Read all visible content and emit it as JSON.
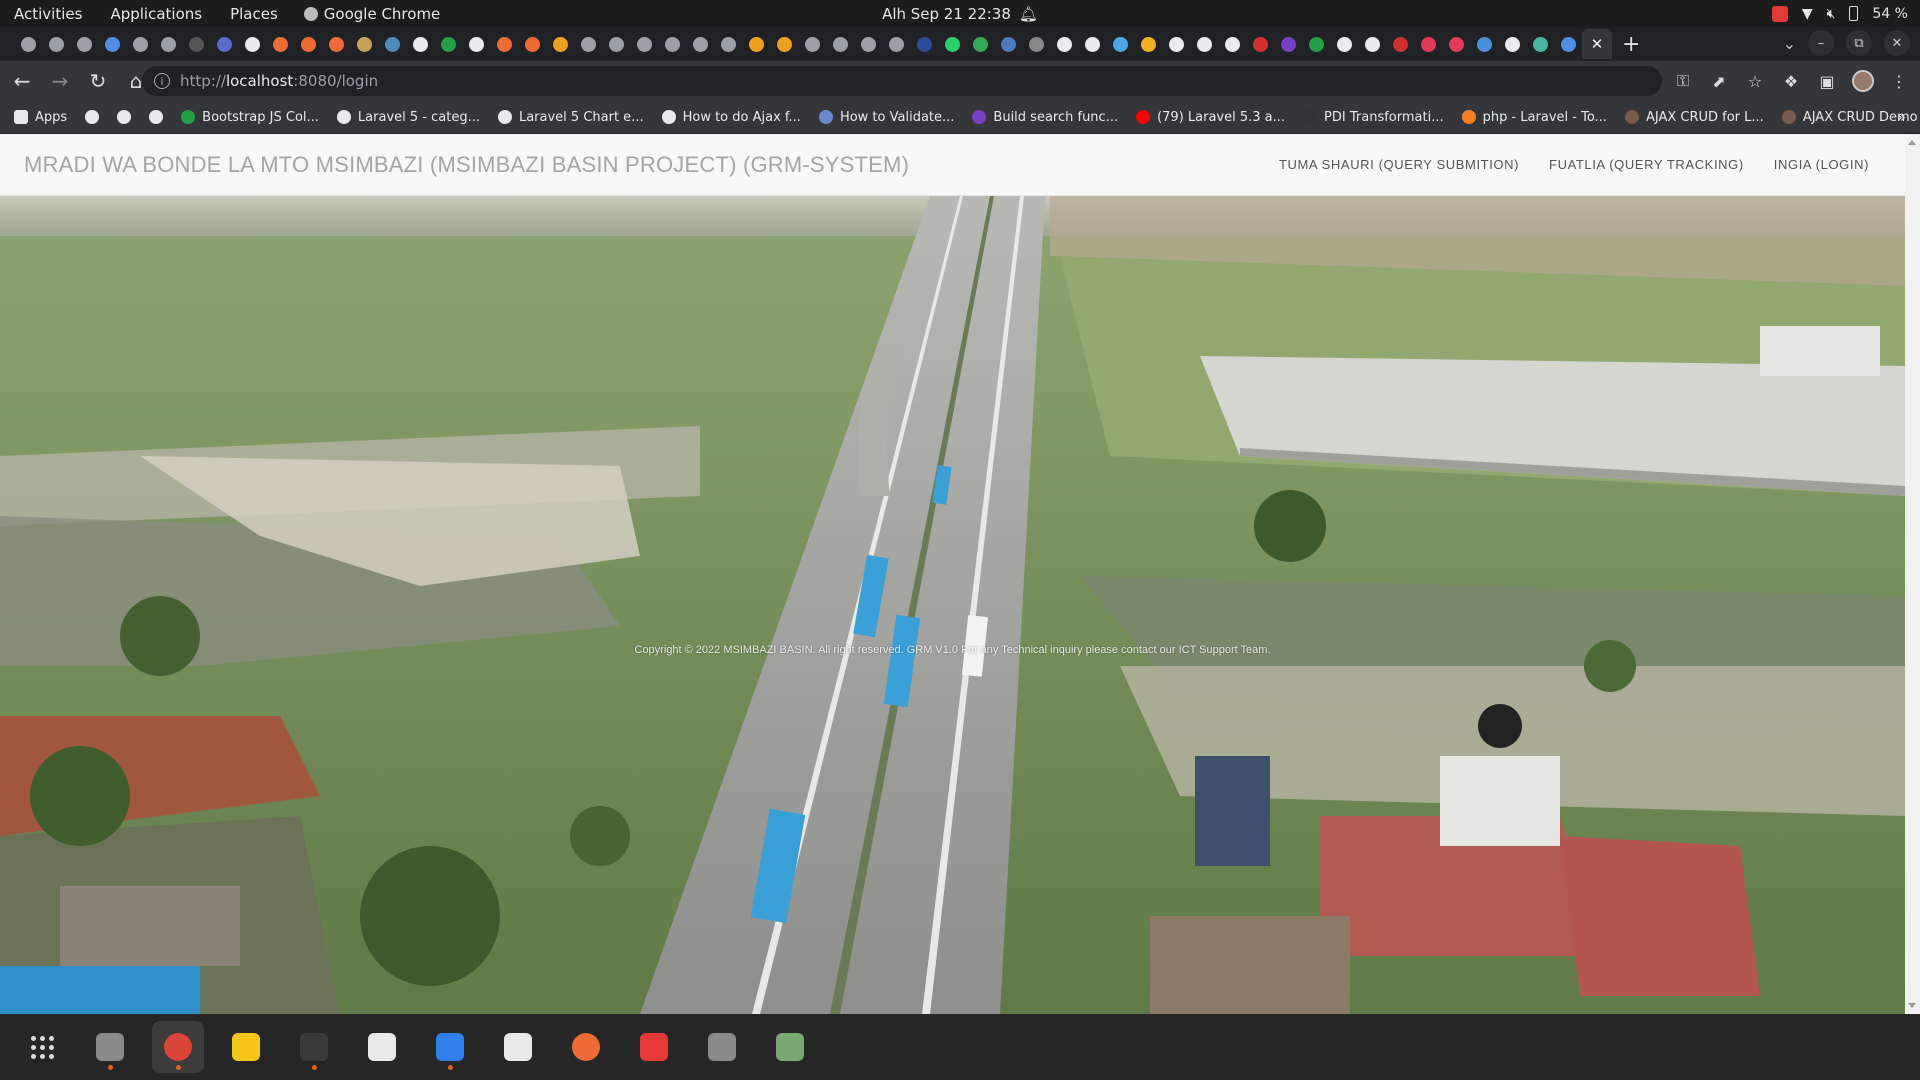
{
  "system_bar": {
    "activities": "Activities",
    "applications": "Applications",
    "places": "Places",
    "active_app": "Google Chrome",
    "clock": "Alh Sep 21  22:38",
    "battery": "54 %"
  },
  "browser": {
    "url_scheme": "http://",
    "url_host": "localhost",
    "url_rest": ":8080/login",
    "tab_favicon_colors": [
      "#9aa0a6",
      "#9aa0a6",
      "#9aa0a6",
      "#4f8ee6",
      "#9aa0a6",
      "#9aa0a6",
      "#555",
      "#5a6acf",
      "#e8eaed",
      "#f06a35",
      "#f06a35",
      "#f06a35",
      "#c8a05a",
      "#4b8bbe",
      "#e8eaed",
      "#24a148",
      "#e8eaed",
      "#f06a35",
      "#f06a35",
      "#f0a020",
      "#9aa0a6",
      "#9aa0a6",
      "#9aa0a6",
      "#9aa0a6",
      "#9aa0a6",
      "#9aa0a6",
      "#f0a020",
      "#f0a020",
      "#9aa0a6",
      "#9aa0a6",
      "#9aa0a6",
      "#9aa0a6",
      "#2a4a9a",
      "#25d366",
      "#34a853",
      "#4a7abf",
      "#888",
      "#e8eaed",
      "#e8eaed",
      "#4aa8e8",
      "#f0b020",
      "#e8eaed",
      "#e8eaed",
      "#e8eaed",
      "#d32f2f",
      "#7a3fc8",
      "#24a148",
      "#e8eaed",
      "#e8eaed",
      "#d32f2f",
      "#e53958",
      "#e53958",
      "#4a90e2",
      "#e8eaed",
      "#4ab5a0",
      "#4f8ee6"
    ],
    "bookmarks": [
      {
        "label": "Apps",
        "color": "#e8eaed"
      },
      {
        "label": "",
        "color": "#e8eaed"
      },
      {
        "label": "",
        "color": "#e8eaed"
      },
      {
        "label": "",
        "color": "#e8eaed"
      },
      {
        "label": "Bootstrap JS Col...",
        "color": "#24a148"
      },
      {
        "label": "Laravel 5 - categ...",
        "color": "#e8eaed"
      },
      {
        "label": "Laravel 5 Chart e...",
        "color": "#e8eaed"
      },
      {
        "label": "How to do Ajax f...",
        "color": "#e8eaed"
      },
      {
        "label": "How to Validate...",
        "color": "#6a8acf"
      },
      {
        "label": "Build search func...",
        "color": "#7a3fc8"
      },
      {
        "label": "(79) Laravel 5.3 a...",
        "color": "#ff0000"
      },
      {
        "label": "PDI Transformati...",
        "color": "#333"
      },
      {
        "label": "php - Laravel - To...",
        "color": "#f48024"
      },
      {
        "label": "AJAX CRUD for L...",
        "color": "#7a5a4a"
      },
      {
        "label": "AJAX CRUD Demo",
        "color": "#7a5a4a"
      }
    ]
  },
  "site": {
    "brand": "MRADI WA BONDE LA MTO MSIMBAZI (MSIMBAZI BASIN PROJECT) (GRM-SYSTEM)",
    "menu": [
      "TUMA SHAURI (QUERY SUBMITION)",
      "FUATLIA (QUERY TRACKING)",
      "INGIA (LOGIN)"
    ],
    "footer": "Copyright © 2022 MSIMBAZI BASIN. All right reserved. GRM V1.0 For any Technical inquiry please contact our ICT Support Team."
  },
  "dock": {
    "apps": [
      {
        "name": "show-apps",
        "color": ""
      },
      {
        "name": "files",
        "color": "#8a8a8a"
      },
      {
        "name": "chrome",
        "color": "#db4437"
      },
      {
        "name": "rhythmbox",
        "color": "#f5c518"
      },
      {
        "name": "terminal",
        "color": "#3a3a3a"
      },
      {
        "name": "inkscape",
        "color": "#e8e8e8"
      },
      {
        "name": "vscode",
        "color": "#2f80ed"
      },
      {
        "name": "text-editor",
        "color": "#e8e8e8"
      },
      {
        "name": "postman",
        "color": "#f06a35"
      },
      {
        "name": "anydesk",
        "color": "#e53935"
      },
      {
        "name": "archive",
        "color": "#8a8a8a"
      },
      {
        "name": "trash",
        "color": "#7aa872"
      }
    ]
  }
}
